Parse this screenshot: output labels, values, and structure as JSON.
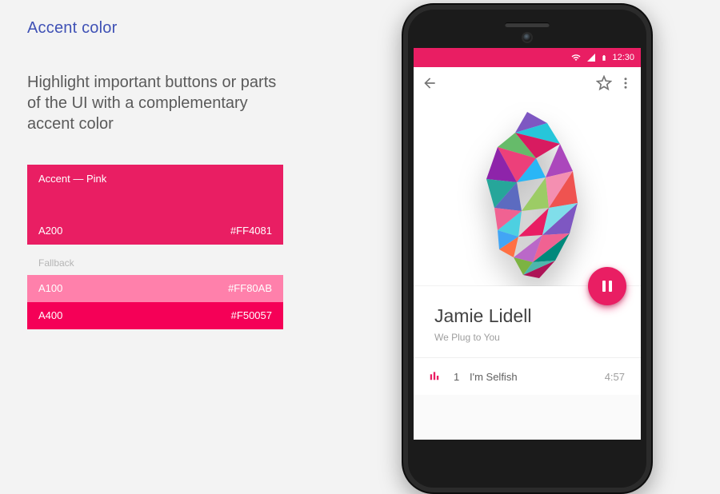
{
  "heading": "Accent color",
  "lede": "Highlight important buttons or parts of the UI with a complementary accent color",
  "swatch": {
    "main": {
      "name": "Accent — Pink",
      "code": "A200",
      "hex": "#FF4081",
      "bg": "#E91E63"
    },
    "fallback_label": "Fallback",
    "rows": [
      {
        "code": "A100",
        "hex": "#FF80AB",
        "bg": "#FF80AB"
      },
      {
        "code": "A400",
        "hex": "#F50057",
        "bg": "#F50057"
      }
    ]
  },
  "phone": {
    "accent": "#E91E63",
    "status_time": "12:30",
    "artist": "Jamie Lidell",
    "album": "We Plug to You",
    "track": {
      "num": "1",
      "name": "I'm Selfish",
      "duration": "4:57"
    }
  }
}
